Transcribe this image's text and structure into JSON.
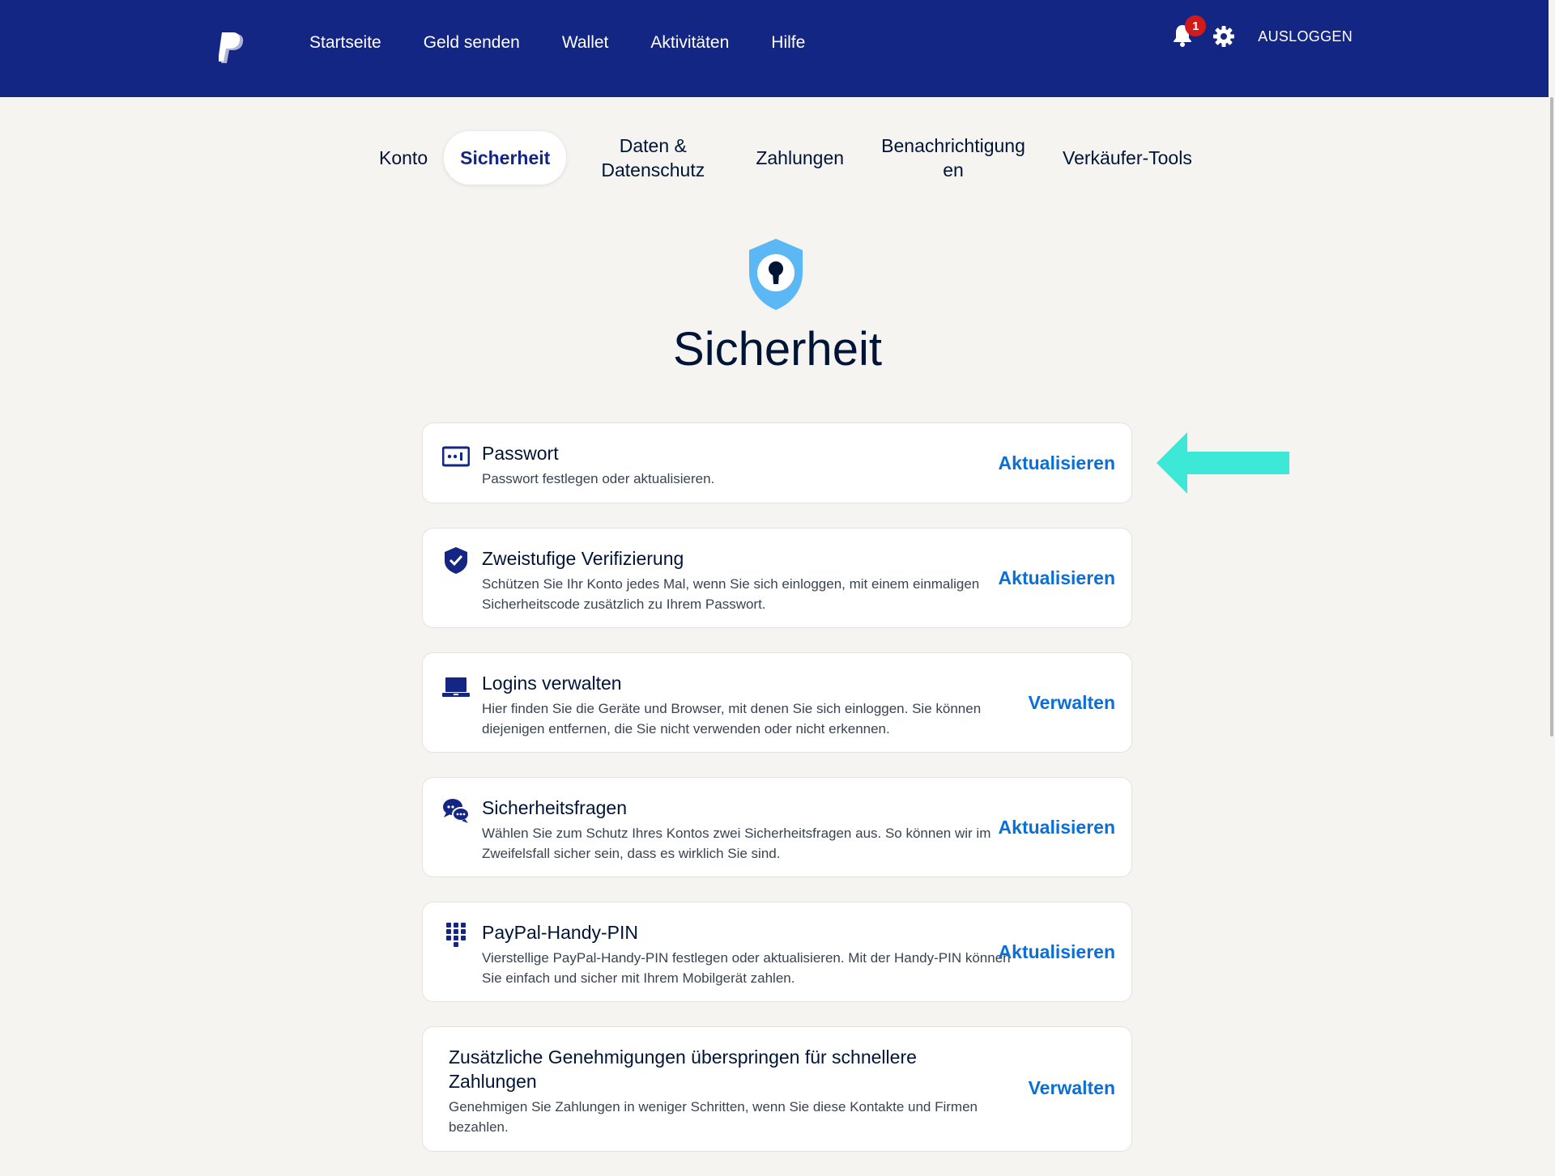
{
  "nav": {
    "items": [
      "Startseite",
      "Geld senden",
      "Wallet",
      "Aktivitäten",
      "Hilfe"
    ],
    "notification_count": "1",
    "logout_label": "AUSLOGGEN"
  },
  "tabs": [
    {
      "label": "Konto"
    },
    {
      "label": "Sicherheit",
      "active": true
    },
    {
      "label": "Daten & Datenschutz"
    },
    {
      "label": "Zahlungen"
    },
    {
      "label": "Benachrichtigungen"
    },
    {
      "label": "Verkäufer-Tools"
    }
  ],
  "page": {
    "title": "Sicherheit",
    "hero_icon": "shield-keyhole-icon"
  },
  "cards": [
    {
      "icon": "password-icon",
      "title": "Passwort",
      "description": "Passwort festlegen oder aktualisieren.",
      "action": "Aktualisieren"
    },
    {
      "icon": "shield-check-icon",
      "title": "Zweistufige Verifizierung",
      "description": "Schützen Sie Ihr Konto jedes Mal, wenn Sie sich einloggen, mit einem einmaligen Sicherheitscode zusätzlich zu Ihrem Passwort.",
      "action": "Aktualisieren"
    },
    {
      "icon": "laptop-icon",
      "title": "Logins verwalten",
      "description": "Hier finden Sie die Geräte und Browser, mit denen Sie sich einloggen. Sie können diejenigen entfernen, die Sie nicht verwenden oder nicht erkennen.",
      "action": "Verwalten"
    },
    {
      "icon": "chat-bubbles-icon",
      "title": "Sicherheitsfragen",
      "description": "Wählen Sie zum Schutz Ihres Kontos zwei Sicherheitsfragen aus. So können wir im Zweifelsfall sicher sein, dass es wirklich Sie sind.",
      "action": "Aktualisieren"
    },
    {
      "icon": "keypad-icon",
      "title": "PayPal-Handy-PIN",
      "description": "Vierstellige PayPal-Handy-PIN festlegen oder aktualisieren. Mit der Handy-PIN können Sie einfach und sicher mit Ihrem Mobilgerät zahlen.",
      "action": "Aktualisieren"
    },
    {
      "icon": "",
      "title": "Zusätzliche Genehmigungen überspringen für schnellere Zahlungen",
      "description": "Genehmigen Sie Zahlungen in weniger Schritten, wenn Sie diese Kontakte und Firmen bezahlen.",
      "action": "Verwalten"
    }
  ],
  "colors": {
    "header_bg": "#142683",
    "link": "#0a6fd6",
    "arrow": "#3de8d6",
    "shield_light": "#5bb8f5"
  }
}
